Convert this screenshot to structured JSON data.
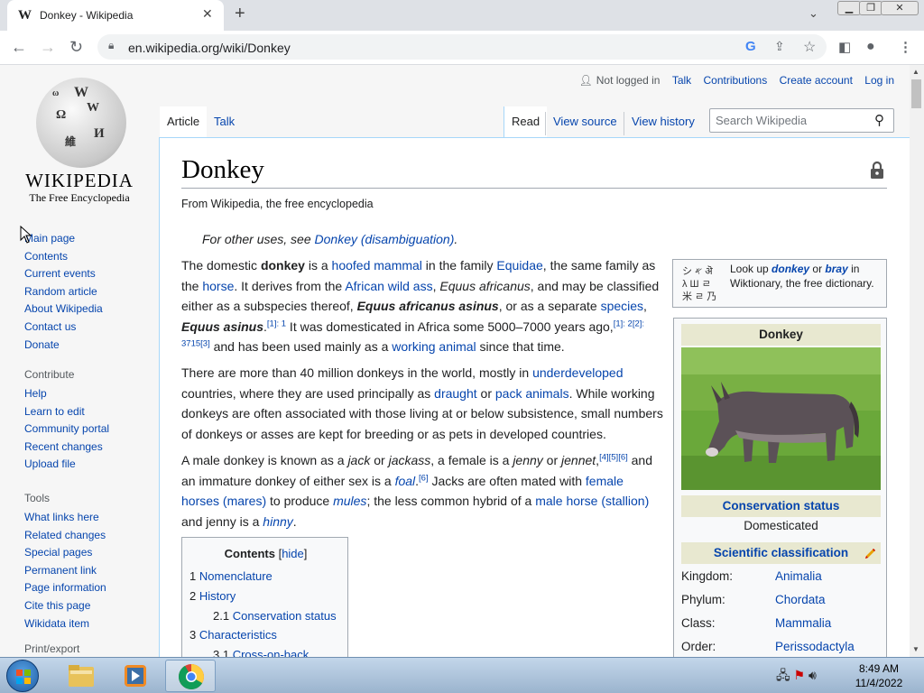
{
  "browser": {
    "tab_title": "Donkey - Wikipedia",
    "tab_favicon": "W",
    "url": "en.wikipedia.org/wiki/Donkey"
  },
  "wiki": {
    "wordmark": "WIKIPEDIA",
    "tagline": "The Free Encyclopedia",
    "user_nav": [
      "Not logged in",
      "Talk",
      "Contributions",
      "Create account",
      "Log in"
    ],
    "ns_tabs": [
      "Article",
      "Talk"
    ],
    "view_tabs": [
      "Read",
      "View source",
      "View history"
    ],
    "search_placeholder": "Search Wikipedia",
    "sidebar_main": [
      "Main page",
      "Contents",
      "Current events",
      "Random article",
      "About Wikipedia",
      "Contact us",
      "Donate"
    ],
    "sidebar_contribute_heading": "Contribute",
    "sidebar_contribute": [
      "Help",
      "Learn to edit",
      "Community portal",
      "Recent changes",
      "Upload file"
    ],
    "sidebar_tools_heading": "Tools",
    "sidebar_tools": [
      "What links here",
      "Related changes",
      "Special pages",
      "Permanent link",
      "Page information",
      "Cite this page",
      "Wikidata item"
    ],
    "sidebar_print_heading": "Print/export"
  },
  "article": {
    "title": "Donkey",
    "from": "From Wikipedia, the free encyclopedia",
    "hatnote_prefix": "For other uses, see ",
    "hatnote_link": "Donkey (disambiguation)",
    "hatnote_suffix": "."
  },
  "wiktionary": {
    "glyphs": "シ 𐤀 ऄ\nλ Ш ㄹ\n米 ㄹ 乃",
    "pre": "Look up ",
    "word1": "donkey",
    "mid": " or ",
    "word2": "bray",
    "post": " in Wiktionary, the free dictionary."
  },
  "infobox": {
    "title": "Donkey",
    "conservation_heading": "Conservation status",
    "conservation_value": "Domesticated",
    "classification_heading": "Scientific classification",
    "rows": [
      {
        "label": "Kingdom:",
        "value": "Animalia"
      },
      {
        "label": "Phylum:",
        "value": "Chordata"
      },
      {
        "label": "Class:",
        "value": "Mammalia"
      },
      {
        "label": "Order:",
        "value": "Perissodactyla"
      }
    ]
  },
  "toc": {
    "title": "Contents",
    "hide": "hide",
    "entries": [
      {
        "num": "1",
        "text": "Nomenclature"
      },
      {
        "num": "2",
        "text": "History"
      },
      {
        "num": "2.1",
        "text": "Conservation status"
      },
      {
        "num": "3",
        "text": "Characteristics"
      },
      {
        "num": "3.1",
        "text": "Cross-on-back"
      }
    ]
  },
  "taskbar": {
    "time": "8:49 AM",
    "date": "11/4/2022"
  },
  "colors": {
    "link": "#0645ad",
    "infobox_header": "#e8e8d0",
    "content_border": "#a7d7f9"
  }
}
